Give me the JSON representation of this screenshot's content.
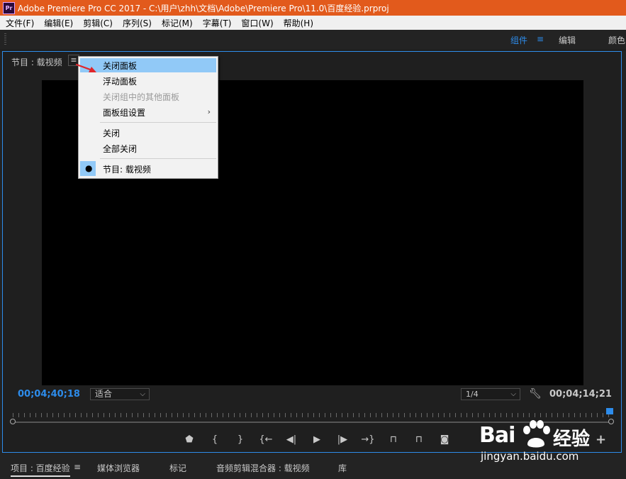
{
  "titlebar": {
    "icon": "Pr",
    "text": "Adobe Premiere Pro CC 2017 - C:\\用户\\zhh\\文档\\Adobe\\Premiere Pro\\11.0\\百度经验.prproj"
  },
  "menubar": {
    "items": [
      "文件(F)",
      "编辑(E)",
      "剪辑(C)",
      "序列(S)",
      "标记(M)",
      "字幕(T)",
      "窗口(W)",
      "帮助(H)"
    ]
  },
  "workspaces": {
    "items": [
      {
        "label": "组件",
        "active": true
      },
      {
        "label": "编辑",
        "active": false
      },
      {
        "label": "颜色",
        "active": false
      }
    ],
    "menu_icon": "≡"
  },
  "monitor": {
    "tab_label": "节目 : 载视频",
    "panel_menu_icon": "≡",
    "timecode_current": "00;04;40;18",
    "zoom_value": "适合",
    "resolution_value": "1/4",
    "timecode_duration": "00;04;14;21"
  },
  "controls": {
    "marker": "⬟",
    "in_point": "{",
    "out_point": "}",
    "goto_in": "{←",
    "step_back": "◀|",
    "play": "▶",
    "step_forward": "|▶",
    "goto_out": "→}",
    "lift": "⊓",
    "extract": "⊓",
    "export_frame": "◙",
    "add": "+"
  },
  "context_menu": {
    "items": [
      {
        "label": "关闭面板",
        "highlighted": true,
        "disabled": false
      },
      {
        "label": "浮动面板",
        "highlighted": false,
        "disabled": false
      },
      {
        "label": "关闭组中的其他面板",
        "highlighted": false,
        "disabled": true
      },
      {
        "label": "面板组设置",
        "highlighted": false,
        "disabled": false,
        "submenu": true
      },
      {
        "label": "关闭",
        "highlighted": false,
        "disabled": false
      },
      {
        "label": "全部关闭",
        "highlighted": false,
        "disabled": false
      },
      {
        "label": "节目: 载视频",
        "highlighted": false,
        "disabled": false,
        "checked": true
      }
    ],
    "submenu_arrow": "›",
    "check_mark": "●"
  },
  "bottom_tabs": {
    "items": [
      {
        "label": "项目 : 百度经验",
        "active": true
      },
      {
        "label": "媒体浏览器",
        "active": false
      },
      {
        "label": "标记",
        "active": false
      },
      {
        "label": "音频剪辑混合器 : 载视频",
        "active": false
      },
      {
        "label": "库",
        "active": false
      }
    ],
    "menu_icon": "≡"
  },
  "watermark": {
    "brand_left": "Bai",
    "brand_right": "经验",
    "url": "jingyan.baidu.com"
  },
  "colors": {
    "titlebar": "#e25a1c",
    "accent": "#2d8ceb",
    "menu_highlight": "#91c9f7",
    "annotation_arrow": "#e0262b"
  }
}
